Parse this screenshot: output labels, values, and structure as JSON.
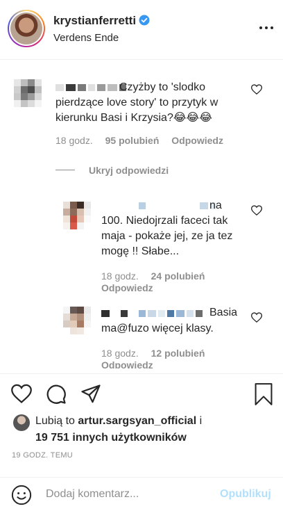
{
  "post": {
    "username": "krystianferretti",
    "location": "Verdens Ende"
  },
  "comments": [
    {
      "text": "Czyżby to 'slodko pierdzące love story' to przytyk w kierunku Basi i Krzysia?😂😂😂",
      "time": "18 godz.",
      "likes": "95 polubień",
      "reply": "Odpowiedz"
    }
  ],
  "hide_replies": "Ukryj odpowiedzi",
  "replies": [
    {
      "line1": "na",
      "rest": "100. Niedojrzali faceci tak maja - pokaże jej, ze ja tez mogę !! Słabe...",
      "time": "18 godz.",
      "likes": "24 polubień",
      "reply": "Odpowiedz"
    },
    {
      "line1": "Basia",
      "rest": "ma@fuzo więcej klasy.",
      "time": "18 godz.",
      "likes": "12 polubień",
      "reply": "Odpowiedz"
    }
  ],
  "liked_by": {
    "prefix": "Lubią to",
    "user": "artur.sargsyan_official",
    "conj": "i",
    "others": "19 751 innych użytkowników"
  },
  "timestamp": "19 GODZ. TEMU",
  "add_comment": {
    "placeholder": "Dodaj komentarz...",
    "post_label": "Opublikuj"
  },
  "colors": {
    "text": "#262626",
    "muted": "#8e8e8e",
    "verified": "#3897f0",
    "post_disabled": "#b2dffc"
  },
  "icons": [
    "verified-icon",
    "more-options-icon",
    "heart-icon",
    "comment-icon",
    "share-icon",
    "bookmark-icon",
    "emoji-icon"
  ]
}
